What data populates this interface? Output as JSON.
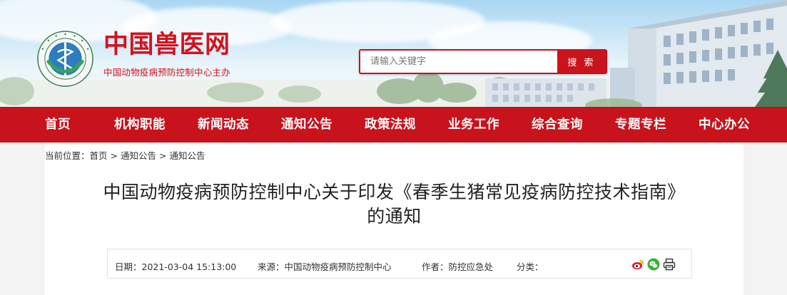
{
  "site": {
    "title": "中国兽医网",
    "subtitle": "中国动物疫病预防控制中心主办"
  },
  "search": {
    "placeholder": "请输入关键字",
    "button_label": "搜 索"
  },
  "nav": {
    "items": [
      "首页",
      "机构职能",
      "新闻动态",
      "通知公告",
      "政策法规",
      "业务工作",
      "综合查询",
      "专题专栏",
      "中心办公"
    ]
  },
  "breadcrumb": {
    "prefix": "当前位置：",
    "items": [
      "首页",
      "通知公告",
      "通知公告"
    ],
    "separator": ">"
  },
  "article": {
    "title_line1": "中国动物疫病预防控制中心关于印发《春季生猪常见疫病防控技术指南》",
    "title_line2": "的通知",
    "date": "日期：2021-03-04 15:13:00",
    "source": "来源：中国动物疫病预防控制中心",
    "author": "作者：防控应急处",
    "category": "分类："
  },
  "share_icons": [
    "weibo-icon",
    "wechat-icon",
    "print-icon"
  ],
  "colors": {
    "brand_red": "#c8121c",
    "nav_text": "#ffffff"
  }
}
